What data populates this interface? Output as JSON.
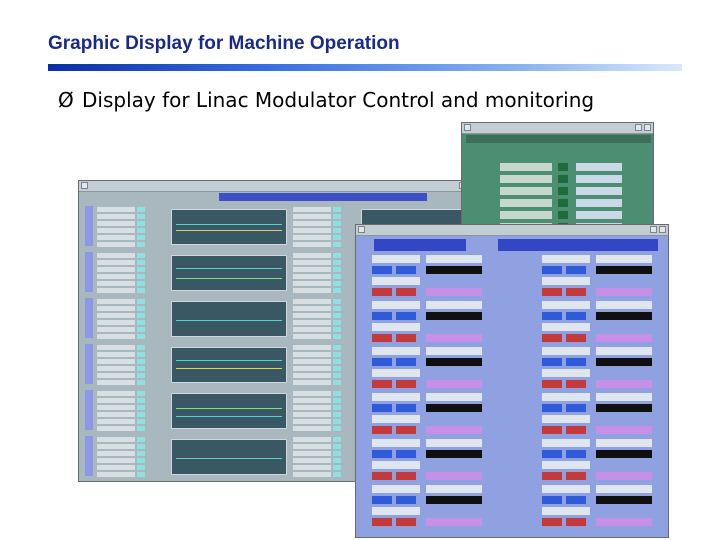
{
  "slide": {
    "title": "Graphic Display for Machine Operation",
    "bullet_arrow": "Ø",
    "bullet_text": "Display for Linac Modulator Control and monitoring"
  },
  "colors": {
    "title": "#1a2a8c",
    "rule_start": "#0a2ea8",
    "rule_end": "#dbe8fb",
    "window_a_bg": "#a9b7bf",
    "window_b_bg": "#4c8e72",
    "window_c_bg": "#8fa1e0"
  },
  "icons": {
    "bullet": "arrowhead-bullet-icon",
    "window_controls": "window-control-icon"
  }
}
